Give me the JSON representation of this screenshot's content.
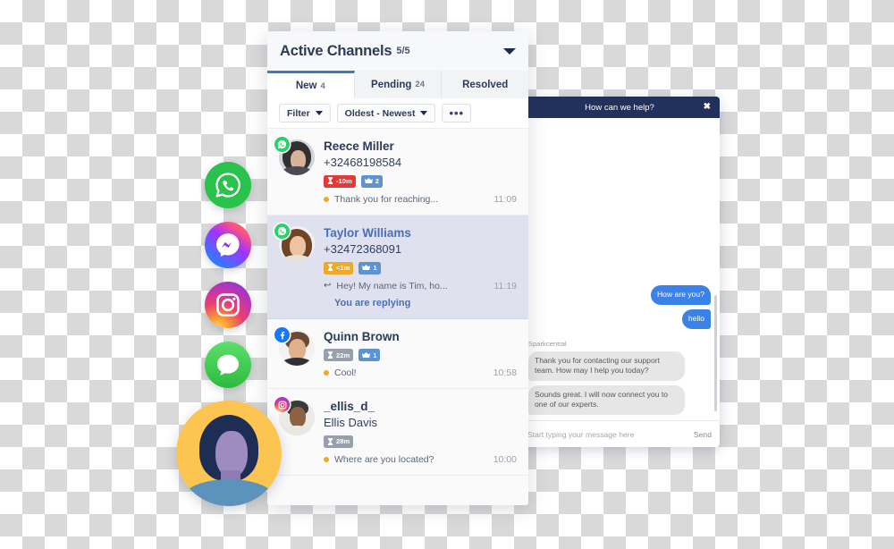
{
  "panel": {
    "title": "Active Channels",
    "title_count": "5/5",
    "caret_icon": "chevron-down-icon",
    "tabs": [
      {
        "label": "New",
        "count": "4",
        "active": true
      },
      {
        "label": "Pending",
        "count": "24",
        "active": false
      },
      {
        "label": "Resolved",
        "count": "",
        "active": false
      }
    ],
    "filters": {
      "filter_label": "Filter",
      "sort_label": "Oldest - Newest",
      "more_label": "•••"
    }
  },
  "conversations": [
    {
      "name": "Reece Miller",
      "subtitle": "+32468198584",
      "channel": "whatsapp",
      "sla": {
        "text": "-10m",
        "tone": "red"
      },
      "priority": "2",
      "preview": "Thank you for reaching...",
      "preview_marker": "unread-dot",
      "time": "11:09",
      "selected": false,
      "status_note": ""
    },
    {
      "name": "Taylor Williams",
      "subtitle": "+32472368091",
      "channel": "whatsapp",
      "sla": {
        "text": "<1m",
        "tone": "orange"
      },
      "priority": "1",
      "preview": "Hey! My name is Tim, ho...",
      "preview_marker": "reply-arrow",
      "time": "11:19",
      "selected": true,
      "status_note": "You are replying"
    },
    {
      "name": "Quinn Brown",
      "subtitle": "",
      "channel": "facebook",
      "sla": {
        "text": "22m",
        "tone": "grey"
      },
      "priority": "1",
      "preview": "Cool!",
      "preview_marker": "unread-dot",
      "time": "10:58",
      "selected": false,
      "status_note": ""
    },
    {
      "name": "_ellis_d_",
      "subtitle": "Ellis Davis",
      "channel": "instagram",
      "sla": {
        "text": "28m",
        "tone": "grey"
      },
      "priority": "",
      "preview": "Where are you located?",
      "preview_marker": "unread-dot",
      "time": "10:00",
      "selected": false,
      "status_note": ""
    }
  ],
  "chat_widget": {
    "header_title": "How can we help?",
    "close_icon": "close-icon",
    "agent_name": "Sparkcentral",
    "messages": [
      {
        "text": "How are you?",
        "from": "visitor"
      },
      {
        "text": "hello",
        "from": "visitor"
      },
      {
        "text": "Thank you for contacting our support team. How may I help you today?",
        "from": "agent"
      },
      {
        "text": "Sounds great. I will now connect you to one of our experts.",
        "from": "agent"
      }
    ],
    "input_placeholder": "Start typing your message here",
    "send_label": "Send"
  },
  "channel_rail": [
    {
      "name": "whatsapp-icon",
      "label": "WhatsApp"
    },
    {
      "name": "messenger-icon",
      "label": "Messenger"
    },
    {
      "name": "instagram-icon",
      "label": "Instagram"
    },
    {
      "name": "sms-icon",
      "label": "SMS"
    }
  ],
  "colors": {
    "accent_blue": "#4178be",
    "header_navy": "#22315c",
    "selected_row": "#dfe2ee",
    "sla_red": "#e23b36",
    "sla_orange": "#f0a828",
    "sla_grey": "#9aa0ab",
    "crown_blue": "#5e92d0",
    "bubble_out": "#3b82e8",
    "bubble_in": "#e6e6e6",
    "hero_avatar_bg": "#fcc552"
  }
}
